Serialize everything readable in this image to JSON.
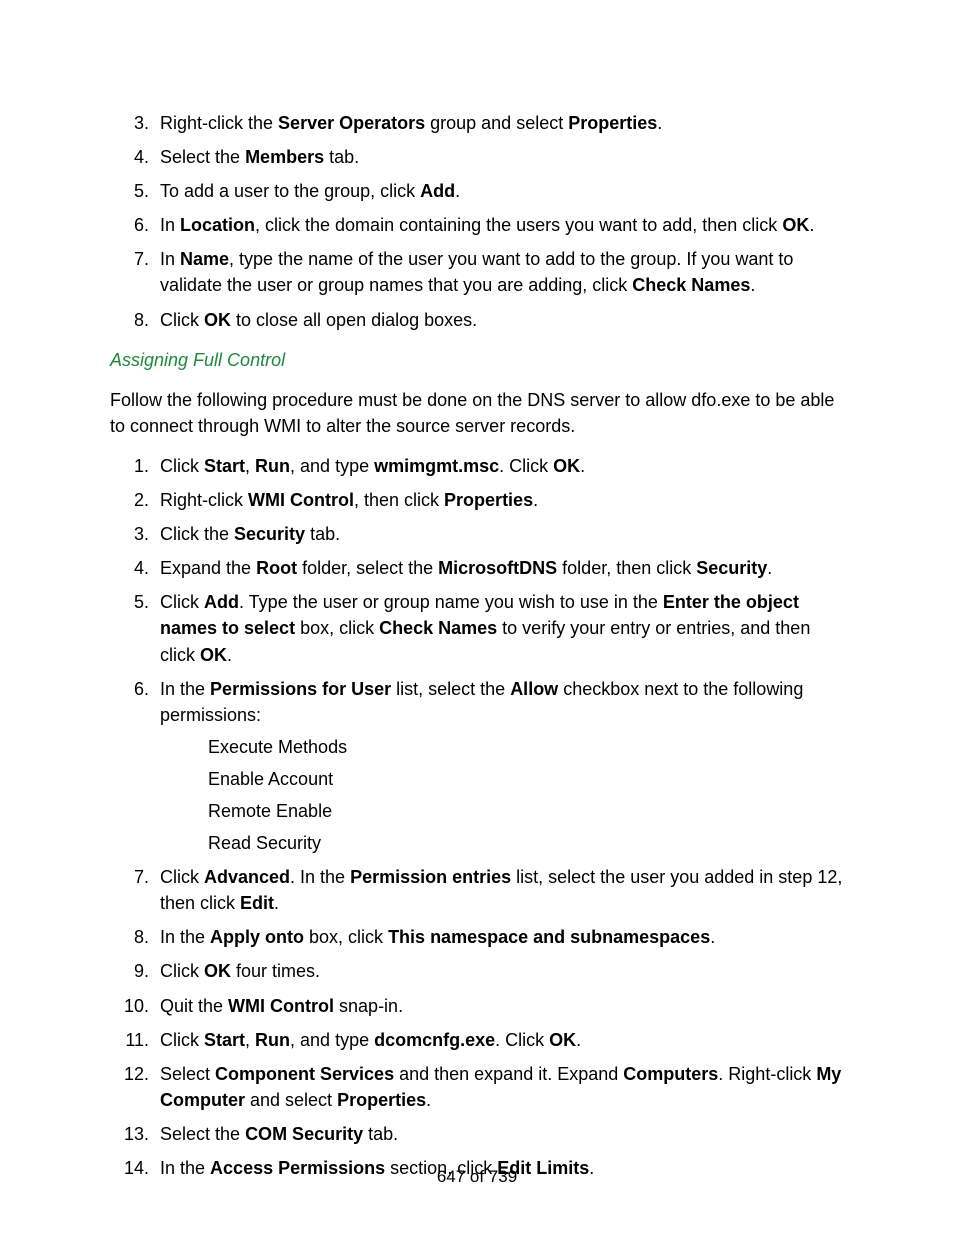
{
  "list1": {
    "start": 3,
    "items": [
      {
        "segs": [
          {
            "t": "Right-click the "
          },
          {
            "t": "Server Operators",
            "b": 1
          },
          {
            "t": " group and select "
          },
          {
            "t": "Properties",
            "b": 1
          },
          {
            "t": "."
          }
        ]
      },
      {
        "segs": [
          {
            "t": "Select the "
          },
          {
            "t": "Members",
            "b": 1
          },
          {
            "t": " tab."
          }
        ]
      },
      {
        "segs": [
          {
            "t": "To add a user to the group, click "
          },
          {
            "t": "Add",
            "b": 1
          },
          {
            "t": "."
          }
        ]
      },
      {
        "segs": [
          {
            "t": "In "
          },
          {
            "t": "Location",
            "b": 1
          },
          {
            "t": ", click the domain containing the users you want to add, then click "
          },
          {
            "t": "OK",
            "b": 1
          },
          {
            "t": "."
          }
        ]
      },
      {
        "segs": [
          {
            "t": "In "
          },
          {
            "t": "Name",
            "b": 1
          },
          {
            "t": ", type the name of the user you want to add to the group. If you want to validate the user or group names that you are adding, click "
          },
          {
            "t": "Check Names",
            "b": 1
          },
          {
            "t": "."
          }
        ]
      },
      {
        "segs": [
          {
            "t": "Click "
          },
          {
            "t": "OK",
            "b": 1
          },
          {
            "t": " to close all open dialog boxes."
          }
        ]
      }
    ]
  },
  "subheading": "Assigning Full Control",
  "intro2": "Follow the following procedure must be done on the DNS server to allow dfo.exe to be able to connect through WMI to alter the source server records.",
  "list2": {
    "start": 1,
    "items": [
      {
        "segs": [
          {
            "t": "Click "
          },
          {
            "t": "Start",
            "b": 1
          },
          {
            "t": ", "
          },
          {
            "t": "Run",
            "b": 1
          },
          {
            "t": ", and type "
          },
          {
            "t": "wmimgmt.msc",
            "b": 1
          },
          {
            "t": ". Click "
          },
          {
            "t": "OK",
            "b": 1
          },
          {
            "t": "."
          }
        ]
      },
      {
        "segs": [
          {
            "t": "Right-click "
          },
          {
            "t": "WMI Control",
            "b": 1
          },
          {
            "t": ", then click "
          },
          {
            "t": "Properties",
            "b": 1
          },
          {
            "t": "."
          }
        ]
      },
      {
        "segs": [
          {
            "t": "Click the "
          },
          {
            "t": "Security",
            "b": 1
          },
          {
            "t": " tab."
          }
        ]
      },
      {
        "segs": [
          {
            "t": "Expand the "
          },
          {
            "t": "Root",
            "b": 1
          },
          {
            "t": " folder, select the "
          },
          {
            "t": "MicrosoftDNS",
            "b": 1
          },
          {
            "t": " folder, then click "
          },
          {
            "t": "Security",
            "b": 1
          },
          {
            "t": "."
          }
        ]
      },
      {
        "segs": [
          {
            "t": "Click "
          },
          {
            "t": "Add",
            "b": 1
          },
          {
            "t": ". Type the user or group name you wish to use in the "
          },
          {
            "t": "Enter the object names to select",
            "b": 1
          },
          {
            "t": " box, click "
          },
          {
            "t": "Check Names",
            "b": 1
          },
          {
            "t": " to verify your entry or entries, and then click "
          },
          {
            "t": "OK",
            "b": 1
          },
          {
            "t": "."
          }
        ]
      },
      {
        "segs": [
          {
            "t": "In the "
          },
          {
            "t": "Permissions for User",
            "b": 1
          },
          {
            "t": " list, select the "
          },
          {
            "t": "Allow",
            "b": 1
          },
          {
            "t": " checkbox next to the following permissions:"
          }
        ],
        "sub": [
          "Execute Methods",
          "Enable Account",
          "Remote Enable",
          "Read Security"
        ]
      },
      {
        "segs": [
          {
            "t": "Click "
          },
          {
            "t": "Advanced",
            "b": 1
          },
          {
            "t": ". In the "
          },
          {
            "t": "Permission entries",
            "b": 1
          },
          {
            "t": " list, select the user you added in step 12, then click "
          },
          {
            "t": "Edit",
            "b": 1
          },
          {
            "t": "."
          }
        ]
      },
      {
        "segs": [
          {
            "t": "In the "
          },
          {
            "t": "Apply onto",
            "b": 1
          },
          {
            "t": " box, click "
          },
          {
            "t": "This namespace and subnamespaces",
            "b": 1
          },
          {
            "t": "."
          }
        ]
      },
      {
        "segs": [
          {
            "t": "Click "
          },
          {
            "t": "OK",
            "b": 1
          },
          {
            "t": " four times."
          }
        ]
      },
      {
        "segs": [
          {
            "t": "Quit the "
          },
          {
            "t": "WMI Control",
            "b": 1
          },
          {
            "t": " snap-in."
          }
        ]
      },
      {
        "segs": [
          {
            "t": "Click "
          },
          {
            "t": "Start",
            "b": 1
          },
          {
            "t": ", "
          },
          {
            "t": "Run",
            "b": 1
          },
          {
            "t": ", and type "
          },
          {
            "t": "dcomcnfg.exe",
            "b": 1
          },
          {
            "t": ". Click "
          },
          {
            "t": "OK",
            "b": 1
          },
          {
            "t": "."
          }
        ]
      },
      {
        "segs": [
          {
            "t": "Select "
          },
          {
            "t": "Component Services",
            "b": 1
          },
          {
            "t": " and then expand it. Expand "
          },
          {
            "t": "Computers",
            "b": 1
          },
          {
            "t": ". Right-click "
          },
          {
            "t": "My Computer",
            "b": 1
          },
          {
            "t": " and select "
          },
          {
            "t": "Properties",
            "b": 1
          },
          {
            "t": "."
          }
        ]
      },
      {
        "segs": [
          {
            "t": "Select the "
          },
          {
            "t": "COM Security",
            "b": 1
          },
          {
            "t": " tab."
          }
        ]
      },
      {
        "segs": [
          {
            "t": "In the "
          },
          {
            "t": "Access Permissions",
            "b": 1
          },
          {
            "t": " section, click "
          },
          {
            "t": "Edit Limits",
            "b": 1
          },
          {
            "t": "."
          }
        ]
      }
    ]
  },
  "footer": "647 of 739"
}
